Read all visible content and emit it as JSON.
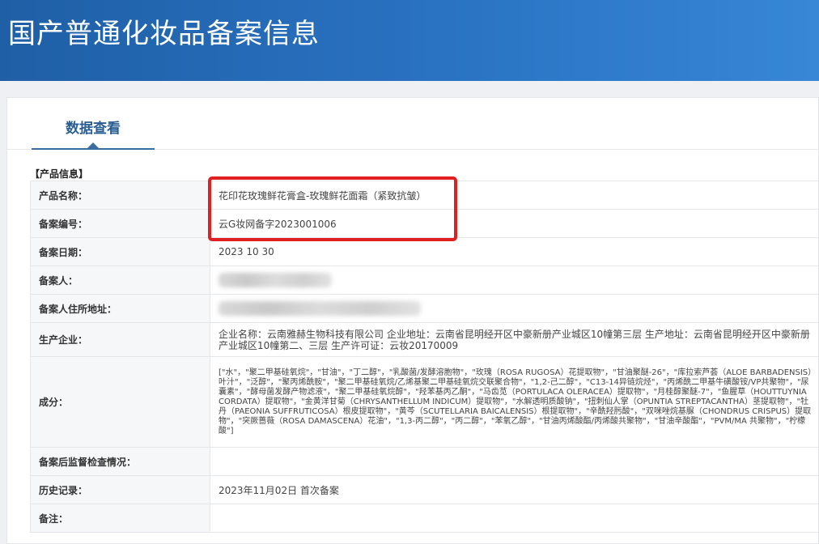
{
  "header": {
    "title": "国产普通化妆品备案信息"
  },
  "tabs": [
    {
      "label": "数据查看"
    }
  ],
  "section": {
    "heading": "【产品信息】"
  },
  "rows": {
    "product_name": {
      "label": "产品名称：",
      "value": "花印花玫瑰鲜花膏盒-玫瑰鲜花面霜（紧致抗皱）"
    },
    "record_number": {
      "label": "备案编号：",
      "value": "云G妆网备字2023001006"
    },
    "record_date": {
      "label": "备案日期：",
      "value": "2023 10 30"
    },
    "registrant": {
      "label": "备案人："
    },
    "registrant_address": {
      "label": "备案人住所地址："
    },
    "manufacturer": {
      "label": "生产企业：",
      "value": "企业名称：云南雅赫生物科技有限公司 企业地址：云南省昆明经开区中豪新册产业城区10幢第三层 生产地址：云南省昆明经开区中豪新册产业城区10幢第二、三层 生产许可证：云妆20170009"
    },
    "ingredients": {
      "label": "成分：",
      "value": "[\"水\"，\"聚二甲基硅氧烷\"，\"甘油\"，\"丁二醇\"，\"乳酸菌/发酵溶胞物\"，\"玫瑰（ROSA RUGOSA）花提取物\"，\"甘油聚醚-26\"，\"库拉索芦荟（ALOE BARBADENSIS）叶汁\"，\"泛醇\"，\"聚丙烯酰胺\"，\"聚二甲基硅氧烷/乙烯基聚二甲基硅氧烷交联聚合物\"，\"1,2-己二醇\"，\"C13-14异链烷烃\"，\"丙烯酰二甲基牛磺酸铵/VP共聚物\"，\"尿囊素\"，\"酵母菌发酵产物滤液\"，\"聚二甲基硅氧烷醇\"，\"羟苯基丙乙酮\"，\"马齿苋（PORTULACA OLERACEA）提取物\"，\"月桂醇聚醚-7\"，\"鱼腥草（HOUTTUYNIA CORDATA）提取物\"，\"金黄洋甘菊（CHRYSANTHELLUM INDICUM）提取物\"，\"水解透明质酸钠\"，\"扭刺仙人掌（OPUNTIA STREPTACANTHA）茎提取物\"，\"牡丹（PAEONIA SUFFRUTICOSA）根皮提取物\"，\"黄芩（SCUTELLARIA BAICALENSIS）根提取物\"，\"辛酰羟肟酸\"，\"双咪唑烷基脲（CHONDRUS CRISPUS）提取物\"，\"突厥蔷薇（ROSA DAMASCENA）花油\"，\"1,3-丙二醇\"，\"丙二醇\"，\"苯氧乙醇\"，\"甘油丙烯酸酯/丙烯酸共聚物\"，\"甘油辛酸酯\"，\"PVM/MA 共聚物\"，\"柠檬酸\"]"
    },
    "post_check": {
      "label": "备案后监督检查情况：",
      "value": ""
    },
    "history": {
      "label": "历史记录：",
      "value": "2023年11月02日 首次备案"
    },
    "remarks": {
      "label": "备注：",
      "value": ""
    }
  },
  "colors": {
    "banner": "#2a73c3",
    "tab_accent": "#3a6da3",
    "highlight": "#e02020"
  }
}
